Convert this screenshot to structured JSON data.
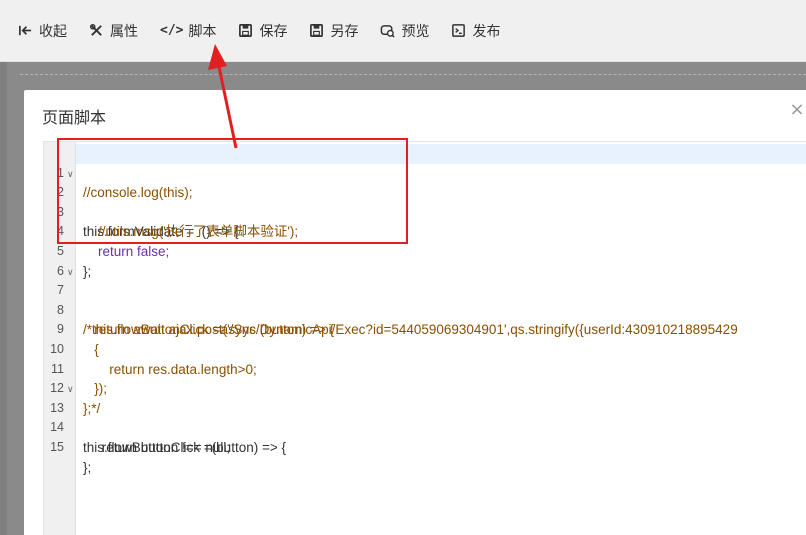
{
  "toolbar": {
    "items": [
      {
        "label": "收起",
        "icon": "collapse-left-icon"
      },
      {
        "label": "属性",
        "icon": "tools-icon"
      },
      {
        "label": "脚本",
        "icon": "code-icon",
        "glyph": "</>"
      },
      {
        "label": "保存",
        "icon": "save-icon"
      },
      {
        "label": "另存",
        "icon": "save-as-icon"
      },
      {
        "label": "预览",
        "icon": "preview-icon"
      },
      {
        "label": "发布",
        "icon": "publish-icon"
      }
    ]
  },
  "modal": {
    "title": "页面脚本",
    "close_glyph": "×"
  },
  "editor": {
    "line_numbers": [
      "1",
      "2",
      "3",
      "4",
      "5",
      "6",
      "7",
      "8",
      "9",
      "10",
      "11",
      "12",
      "13",
      "14",
      "15"
    ],
    "fold_markers": [
      "2",
      "7",
      "13"
    ],
    "lines": [
      "//console.log(this);",
      "this.formValidate =  () => {",
      "    //utils.msg('执行了表单脚本验证');",
      "    return false;",
      "};",
      "",
      "/*this.flowButtonClick =async (button) => {",
      "   return await ajax.post('/Sys/DynamicApi/Exec?id=544059069304901',qs.stringify({userId:430910218895429",
      "   {",
      "       return res.data.length>0;",
      "   });",
      "};*/",
      "this.flowButtonClick =(button) => {",
      "     return button !== null;",
      "};"
    ]
  },
  "colors": {
    "highlight": "#e02020",
    "comment": "#8a4f00",
    "keyword": "#6f2da8",
    "param": "#2037c6"
  }
}
